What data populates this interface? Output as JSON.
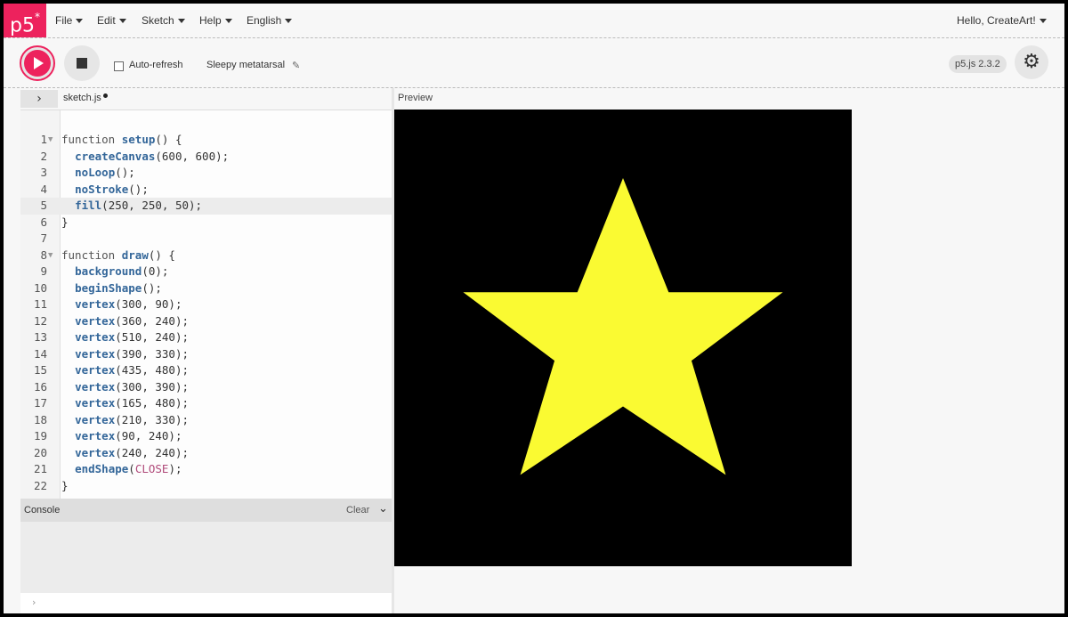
{
  "nav": {
    "logo": "p5",
    "logo_sup": "*",
    "menus": [
      {
        "label": "File"
      },
      {
        "label": "Edit"
      },
      {
        "label": "Sketch"
      },
      {
        "label": "Help"
      },
      {
        "label": "English"
      }
    ],
    "user": "Hello, CreateArt!"
  },
  "toolbar": {
    "auto_refresh_label": "Auto-refresh",
    "auto_refresh_checked": false,
    "sketch_name": "Sleepy metatarsal",
    "version": "p5.js 2.3.2"
  },
  "editor": {
    "file_name": "sketch.js",
    "unsaved": true,
    "active_line": 5,
    "lines": [
      {
        "n": "1",
        "fold": true,
        "code": "function setup() {"
      },
      {
        "n": "2",
        "code": "  createCanvas(600, 600);"
      },
      {
        "n": "3",
        "code": "  noLoop();"
      },
      {
        "n": "4",
        "code": "  noStroke();"
      },
      {
        "n": "5",
        "code": "  fill(250, 250, 50);"
      },
      {
        "n": "6",
        "code": "}"
      },
      {
        "n": "7",
        "code": ""
      },
      {
        "n": "8",
        "fold": true,
        "code": "function draw() {"
      },
      {
        "n": "9",
        "code": "  background(0);"
      },
      {
        "n": "10",
        "code": "  beginShape();"
      },
      {
        "n": "11",
        "code": "  vertex(300, 90);"
      },
      {
        "n": "12",
        "code": "  vertex(360, 240);"
      },
      {
        "n": "13",
        "code": "  vertex(510, 240);"
      },
      {
        "n": "14",
        "code": "  vertex(390, 330);"
      },
      {
        "n": "15",
        "code": "  vertex(435, 480);"
      },
      {
        "n": "16",
        "code": "  vertex(300, 390);"
      },
      {
        "n": "17",
        "code": "  vertex(165, 480);"
      },
      {
        "n": "18",
        "code": "  vertex(210, 330);"
      },
      {
        "n": "19",
        "code": "  vertex(90, 240);"
      },
      {
        "n": "20",
        "code": "  vertex(240, 240);"
      },
      {
        "n": "21",
        "code": "  endShape(CLOSE);"
      },
      {
        "n": "22",
        "code": "}"
      }
    ]
  },
  "console": {
    "title": "Console",
    "clear_label": "Clear"
  },
  "preview": {
    "label": "Preview",
    "canvas_background": "#000000",
    "star_fill": "#fafa32"
  },
  "colors": {
    "accent": "#ed225d"
  }
}
